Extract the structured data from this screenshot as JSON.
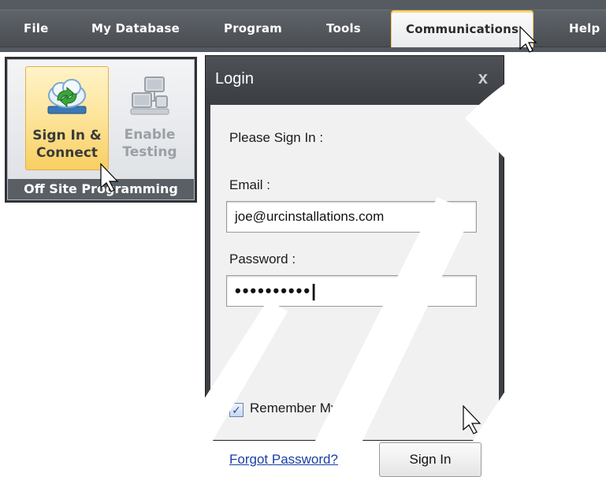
{
  "menubar": {
    "items": [
      "File",
      "My Database",
      "Program",
      "Tools",
      "Communications",
      "Help"
    ],
    "active": "Communications"
  },
  "ribbon": {
    "group_label": "Off Site Programming",
    "buttons": [
      {
        "line1": "Sign In &",
        "line2": "Connect",
        "icon": "cloud-sync-icon",
        "state": "highlighted"
      },
      {
        "line1": "Enable",
        "line2": "Testing",
        "icon": "network-computers-icon",
        "state": "disabled"
      }
    ]
  },
  "dialog": {
    "title": "Login",
    "close_symbol": "x",
    "prompt": "Please Sign In :",
    "email_label": "Email :",
    "email_value": "joe@urcinstallations.com",
    "password_label": "Password :",
    "password_value": "••••••••••|",
    "remember_label": "Remember My Email",
    "remember_checked": true,
    "forgot_link": "Forgot Password?",
    "signin_button": "Sign In"
  },
  "colors": {
    "menubar": "#555a60",
    "active_tab_border": "#f2c55c",
    "highlight": "#fde49a",
    "dialog_frame": "#3c3f44",
    "link": "#1a3fa8"
  }
}
